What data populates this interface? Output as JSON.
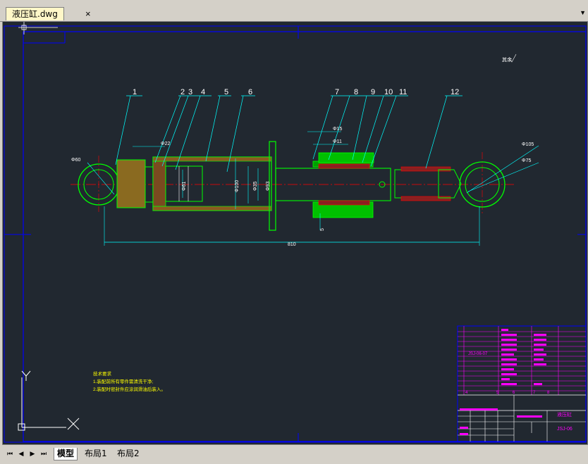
{
  "document_tab": {
    "title": "液压缸.dwg",
    "close_glyph": "×"
  },
  "layout_tabs": [
    {
      "label": "模型",
      "active": true
    },
    {
      "label": "布局1",
      "active": false
    },
    {
      "label": "布局2",
      "active": false
    }
  ],
  "nav_buttons": [
    "⏮",
    "◀",
    "▶",
    "⏭"
  ],
  "drawing": {
    "balloons": [
      "1",
      "2",
      "3",
      "4",
      "5",
      "6",
      "7",
      "8",
      "9",
      "10",
      "11",
      "12"
    ],
    "dims": {
      "d60": "Φ60",
      "d22": "Φ22",
      "d15": "Φ15",
      "d11": "Φ11",
      "d105": "Φ105",
      "d75": "Φ75",
      "d61": "Φ61",
      "d100": "Φ100",
      "d35": "Φ35",
      "d93": "Φ93",
      "len": "810",
      "d5": "5"
    },
    "roughness": "其余",
    "notes": {
      "title": "技术要求",
      "line1": "1.装配前所有零件需清洗干净;",
      "line2": "2.装配时密封件应涂润滑油后装入。"
    },
    "title_block": {
      "drawing_name": "液压缸",
      "drawing_no": "JSJ-06",
      "part_code": "JSJ-06-07",
      "mark_digits": [
        "4",
        "5",
        "6",
        "7",
        "8"
      ]
    },
    "ucs": {
      "y": "Y",
      "x": "X"
    }
  },
  "colors": {
    "canvas_bg": "#212830",
    "line_cyan": "#00ffff",
    "line_green": "#00ff00",
    "line_red": "#ff0000",
    "line_blue": "#0000ff",
    "line_magenta": "#ff00ff",
    "line_yellow": "#ffff00"
  }
}
